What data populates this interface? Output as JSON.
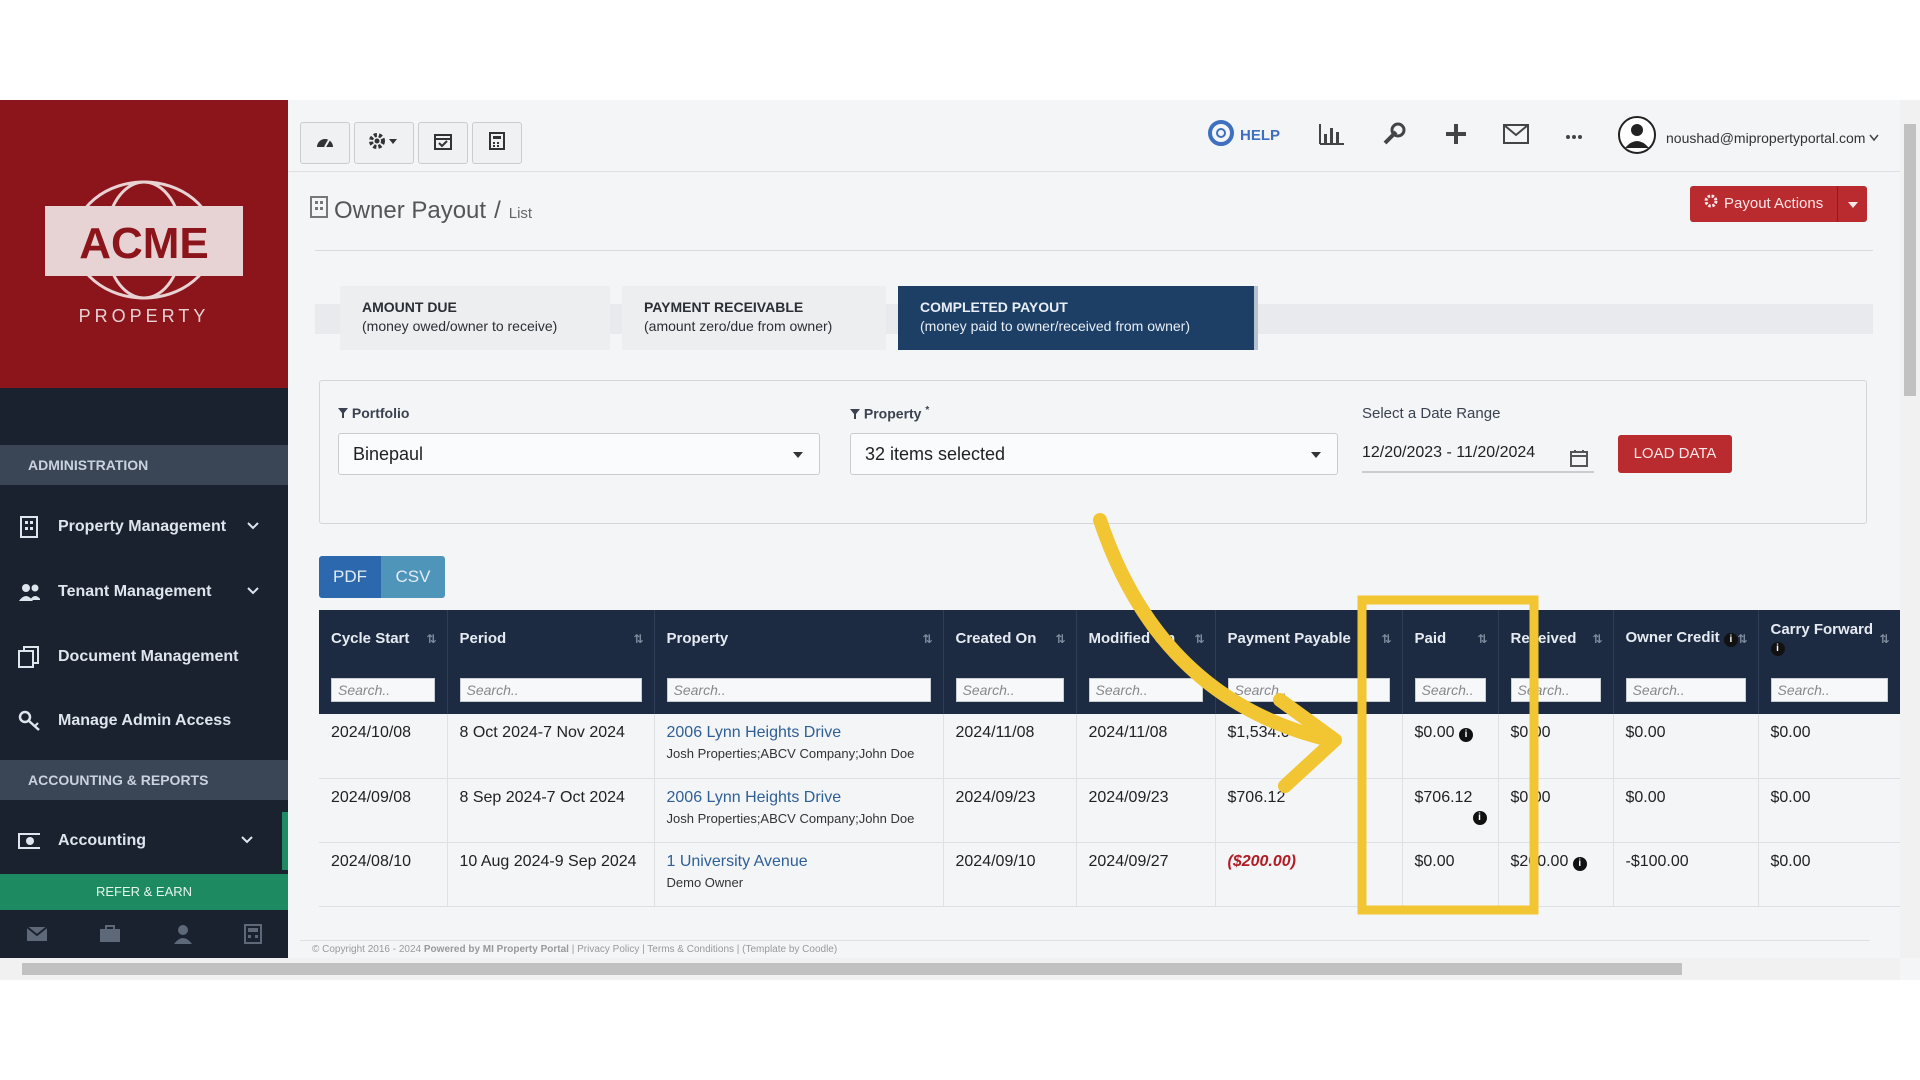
{
  "brand": {
    "logo_text": "ACME",
    "logo_sub": "PROPERTY"
  },
  "sidebar": {
    "section_admin": "ADMINISTRATION",
    "items": [
      {
        "label": "Property Management",
        "icon": "building-icon"
      },
      {
        "label": "Tenant Management",
        "icon": "users-icon"
      },
      {
        "label": "Document Management",
        "icon": "documents-icon"
      },
      {
        "label": "Manage Admin Access",
        "icon": "key-icon"
      }
    ],
    "section_accounting": "ACCOUNTING & REPORTS",
    "accounting_label": "Accounting",
    "refer_label": "REFER & EARN"
  },
  "topbar": {
    "help_label": "HELP",
    "user_email": "noushad@mipropertyportal.com"
  },
  "page": {
    "title": "Owner Payout",
    "separator": "/",
    "crumb": "List",
    "actions_label": "Payout Actions"
  },
  "tabs": [
    {
      "title": "AMOUNT DUE",
      "sub": "(money owed/owner to receive)"
    },
    {
      "title": "PAYMENT RECEIVABLE",
      "sub": "(amount zero/due from owner)"
    },
    {
      "title": "COMPLETED PAYOUT",
      "sub": "(money paid to owner/received from owner)"
    }
  ],
  "filters": {
    "portfolio_label": "Portfolio",
    "portfolio_value": "Binepaul",
    "property_label": "Property",
    "property_required": "*",
    "property_value": "32 items selected",
    "date_label": "Select a Date Range",
    "date_value": "12/20/2023 - 11/20/2024",
    "load_label": "LOAD DATA"
  },
  "export": {
    "pdf": "PDF",
    "csv": "CSV"
  },
  "table": {
    "headers": [
      "Cycle Start",
      "Period",
      "Property",
      "Created On",
      "Modified On",
      "Payment Payable",
      "Paid",
      "Received",
      "Owner Credit",
      "Carry Forward"
    ],
    "search_placeholder": "Search..",
    "rows": [
      {
        "cycle": "2024/10/08",
        "period": "8 Oct 2024-7 Nov 2024",
        "property": "2006 Lynn Heights Drive",
        "owner": "Josh Properties;ABCV Company;John Doe",
        "created": "2024/11/08",
        "modified": "2024/11/08",
        "payable": "$1,534.04",
        "paid": "$0.00",
        "received": "$0.00",
        "credit": "$0.00",
        "carry": "$0.00"
      },
      {
        "cycle": "2024/09/08",
        "period": "8 Sep 2024-7 Oct 2024",
        "property": "2006 Lynn Heights Drive",
        "owner": "Josh Properties;ABCV Company;John Doe",
        "created": "2024/09/23",
        "modified": "2024/09/23",
        "payable": "$706.12",
        "paid": "$706.12",
        "received": "$0.00",
        "credit": "$0.00",
        "carry": "$0.00"
      },
      {
        "cycle": "2024/08/10",
        "period": "10 Aug 2024-9 Sep 2024",
        "property": "1 University Avenue",
        "owner": "Demo Owner",
        "created": "2024/09/10",
        "modified": "2024/09/27",
        "payable": "($200.00)",
        "paid": "$0.00",
        "received": "$200.00",
        "credit": "-$100.00",
        "carry": "$0.00"
      }
    ]
  },
  "footer": {
    "copyright": "© Copyright 2016 - 2024",
    "powered": "Powered by MI Property Portal",
    "links": "| Privacy Policy | Terms & Conditions | (Template by Coodle)"
  },
  "colors": {
    "brand_red": "#8c141b",
    "highlight": "#f2c533",
    "active_tab": "#1d3f66",
    "header_bg": "#1d2b42"
  }
}
